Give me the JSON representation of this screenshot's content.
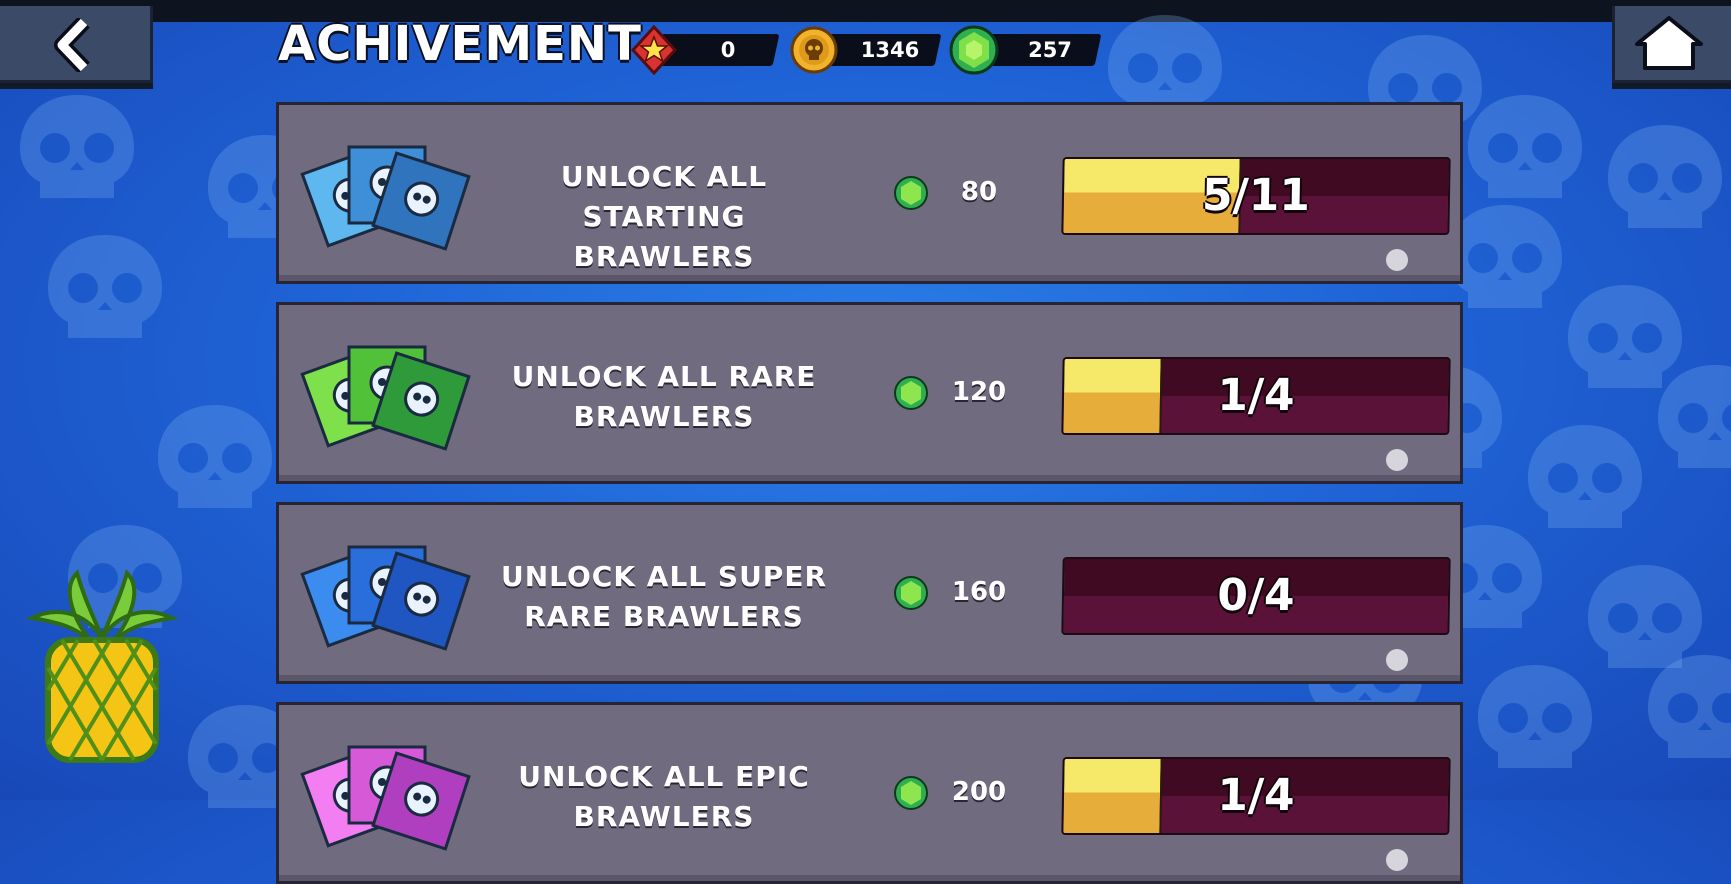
{
  "header": {
    "title": "ACHIVEMENT",
    "resources": [
      {
        "icon": "star-token-icon",
        "value": "0"
      },
      {
        "icon": "skull-coin-icon",
        "value": "1346"
      },
      {
        "icon": "gem-icon",
        "value": "257"
      }
    ]
  },
  "achievements": [
    {
      "label": "UNLOCK ALL STARTING BRAWLERS",
      "reward": "80",
      "progress": "5/11",
      "fraction": 0.4545,
      "color": "blue",
      "card_colors": [
        "#5fb7f0",
        "#3f8fd8",
        "#2f74bd"
      ]
    },
    {
      "label": "UNLOCK ALL RARE BRAWLERS",
      "reward": "120",
      "progress": "1/4",
      "fraction": 0.25,
      "color": "green",
      "card_colors": [
        "#7ee04a",
        "#52c13a",
        "#2e9a3a"
      ]
    },
    {
      "label": "UNLOCK ALL SUPER RARE BRAWLERS",
      "reward": "160",
      "progress": "0/4",
      "fraction": 0,
      "color": "blue-dark",
      "card_colors": [
        "#3c8cf0",
        "#2a6edc",
        "#1f56c2"
      ]
    },
    {
      "label": "UNLOCK ALL EPIC BRAWLERS",
      "reward": "200",
      "progress": "1/4",
      "fraction": 0.25,
      "color": "purple",
      "card_colors": [
        "#f27ef2",
        "#d65ad8",
        "#b03fc0"
      ]
    }
  ],
  "colors": {
    "panel": "#716b80",
    "bar_empty": "#5b1238",
    "bar_fill": "#f6e96a",
    "background": "#1f63d6"
  }
}
